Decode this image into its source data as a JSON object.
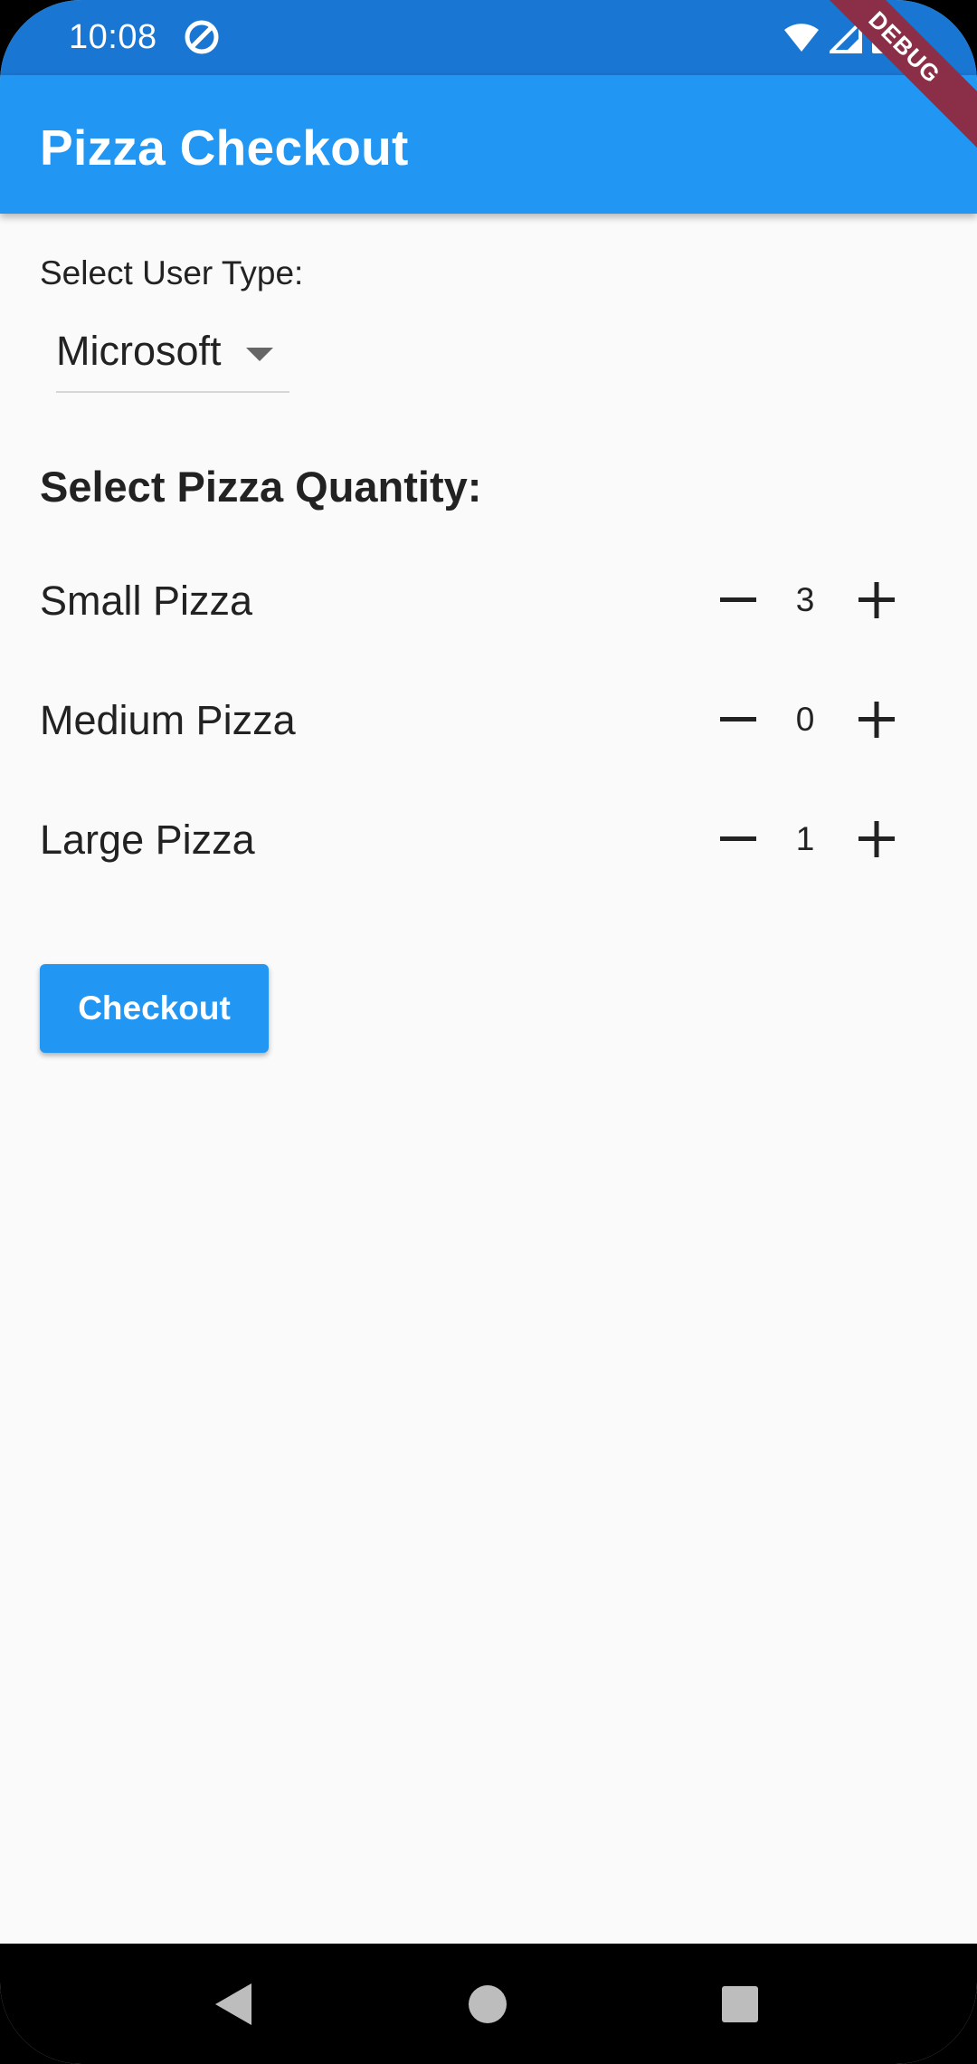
{
  "status_bar": {
    "time": "10:08",
    "background_color": "#1976d2",
    "icons": [
      "app-notification-icon",
      "wifi-icon",
      "signal-icon",
      "battery-icon"
    ]
  },
  "app_bar": {
    "title": "Pizza Checkout",
    "background_color": "#2196f3",
    "debug_banner": "DEBUG"
  },
  "form": {
    "user_type_label": "Select User Type:",
    "user_type_selected": "Microsoft",
    "quantity_heading": "Select Pizza Quantity:",
    "pizzas": [
      {
        "label": "Small Pizza",
        "quantity": "3"
      },
      {
        "label": "Medium Pizza",
        "quantity": "0"
      },
      {
        "label": "Large Pizza",
        "quantity": "1"
      }
    ],
    "checkout_label": "Checkout"
  },
  "nav_bar": {
    "icons": [
      "back-icon",
      "home-icon",
      "recents-icon"
    ]
  }
}
